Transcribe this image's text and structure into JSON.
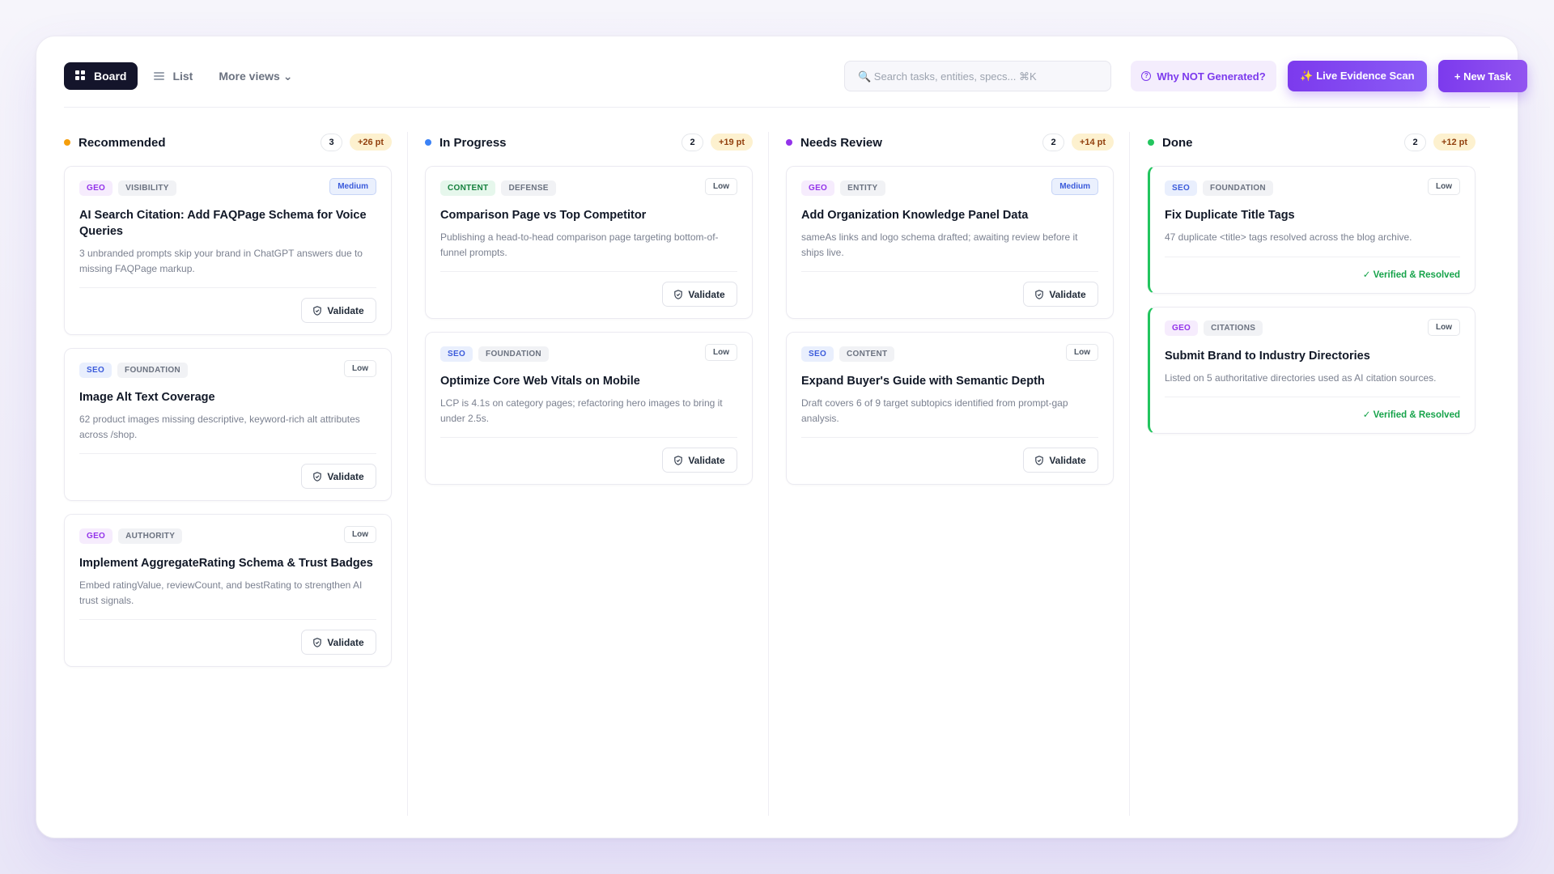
{
  "toolbar": {
    "board_label": "Board",
    "list_label": "List",
    "more_views_label": "More views ⌄",
    "search_placeholder": "🔍 Search tasks, entities, specs... ⌘K",
    "why_label": "Why NOT Generated?",
    "scan_label": "✨ Live Evidence Scan",
    "new_task_label": "+ New Task"
  },
  "colors": {
    "accent": "#7c3aed",
    "recommended": "#f59e0b",
    "in_progress": "#3b82f6",
    "needs_review": "#9333ea",
    "done": "#22c55e"
  },
  "columns": [
    {
      "title": "Recommended",
      "count": "3",
      "points": "+26 pt",
      "cards": [
        {
          "tags": [
            "GEO",
            "VISIBILITY"
          ],
          "priority": "Medium",
          "title": "AI Search Citation: Add FAQPage Schema for Voice Queries",
          "desc": "3 unbranded prompts skip your brand in ChatGPT answers due to missing FAQPage markup.",
          "action": "Validate"
        },
        {
          "tags": [
            "SEO",
            "FOUNDATION"
          ],
          "priority": "Low",
          "title": "Image Alt Text Coverage",
          "desc": "62 product images missing descriptive, keyword-rich alt attributes across /shop.",
          "action": "Validate"
        },
        {
          "tags": [
            "GEO",
            "AUTHORITY"
          ],
          "priority": "Low",
          "title": "Implement AggregateRating Schema & Trust Badges",
          "desc": "Embed ratingValue, reviewCount, and bestRating to strengthen AI trust signals.",
          "action": "Validate"
        }
      ]
    },
    {
      "title": "In Progress",
      "count": "2",
      "points": "+19 pt",
      "cards": [
        {
          "tags": [
            "CONTENT",
            "DEFENSE"
          ],
          "priority": "Low",
          "title": "Comparison Page vs Top Competitor",
          "desc": "Publishing a head-to-head comparison page targeting bottom-of-funnel prompts.",
          "action": "Validate"
        },
        {
          "tags": [
            "SEO",
            "FOUNDATION"
          ],
          "priority": "Low",
          "title": "Optimize Core Web Vitals on Mobile",
          "desc": "LCP is 4.1s on category pages; refactoring hero images to bring it under 2.5s.",
          "action": "Validate"
        }
      ]
    },
    {
      "title": "Needs Review",
      "count": "2",
      "points": "+14 pt",
      "cards": [
        {
          "tags": [
            "GEO",
            "ENTITY"
          ],
          "priority": "Medium",
          "title": "Add Organization Knowledge Panel Data",
          "desc": "sameAs links and logo schema drafted; awaiting review before it ships live.",
          "action": "Validate"
        },
        {
          "tags": [
            "SEO",
            "CONTENT"
          ],
          "priority": "Low",
          "title": "Expand Buyer's Guide with Semantic Depth",
          "desc": "Draft covers 6 of 9 target subtopics identified from prompt-gap analysis.",
          "action": "Validate"
        }
      ]
    },
    {
      "title": "Done",
      "count": "2",
      "points": "+12 pt",
      "cards": [
        {
          "tags": [
            "SEO",
            "FOUNDATION"
          ],
          "priority": "Low",
          "title": "Fix Duplicate Title Tags",
          "desc": "47 duplicate <title> tags resolved across the blog archive.",
          "status": "✓ Verified & Resolved"
        },
        {
          "tags": [
            "GEO",
            "CITATIONS"
          ],
          "priority": "Low",
          "title": "Submit Brand to Industry Directories",
          "desc": "Listed on 5 authoritative directories used as AI citation sources.",
          "status": "✓ Verified & Resolved"
        }
      ]
    }
  ]
}
